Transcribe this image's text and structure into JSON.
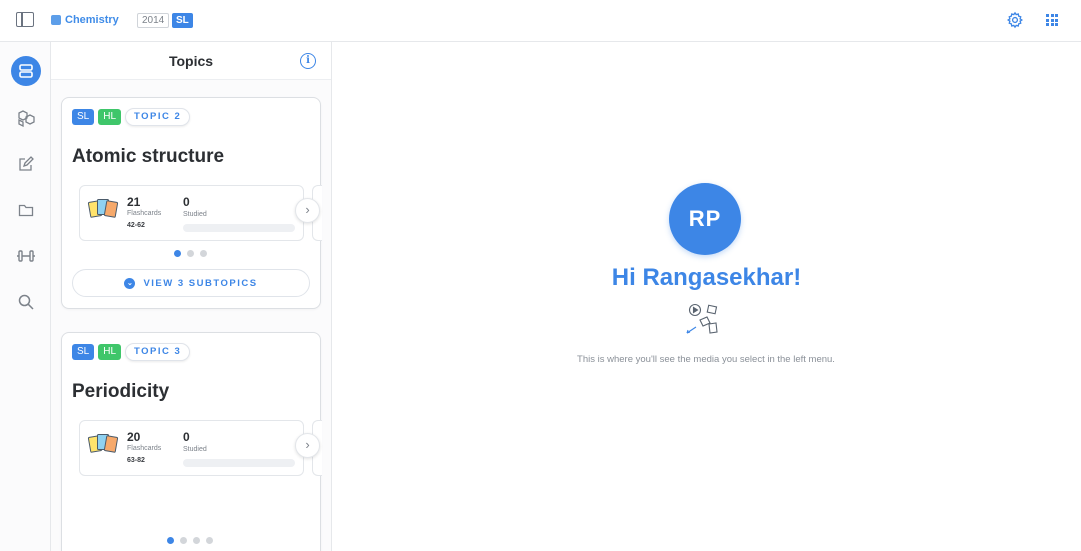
{
  "topbar": {
    "subject": "Chemistry",
    "year": "2014",
    "level": "SL"
  },
  "panel": {
    "title": "Topics",
    "topics": [
      {
        "tags": [
          "SL",
          "HL"
        ],
        "topic_label": "TOPIC 2",
        "title": "Atomic structure",
        "flashcards_count": "21",
        "flashcards_label": "Flashcards",
        "flashcards_range": "42-62",
        "studied_count": "0",
        "studied_label": "Studied",
        "studied_progress": 0,
        "subtopics_label": "VIEW 3 SUBTOPICS"
      },
      {
        "tags": [
          "SL",
          "HL"
        ],
        "topic_label": "TOPIC 3",
        "title": "Periodicity",
        "flashcards_count": "20",
        "flashcards_label": "Flashcards",
        "flashcards_range": "63-82",
        "studied_count": "0",
        "studied_label": "Studied",
        "studied_progress": 0
      }
    ]
  },
  "main": {
    "avatar_initials": "RP",
    "greeting": "Hi Rangasekhar!",
    "hint": "This is where you'll see the media you select in the left menu."
  },
  "colors": {
    "accent": "#3d86e6",
    "hl_green": "#3fc66a"
  },
  "icons": {
    "rail": [
      "stack-icon",
      "cubes-icon",
      "edit-icon",
      "folder-icon",
      "dumbbell-icon",
      "search-icon"
    ],
    "topbar": [
      "sidebar-toggle-icon",
      "gear-icon",
      "apps-grid-icon"
    ]
  }
}
